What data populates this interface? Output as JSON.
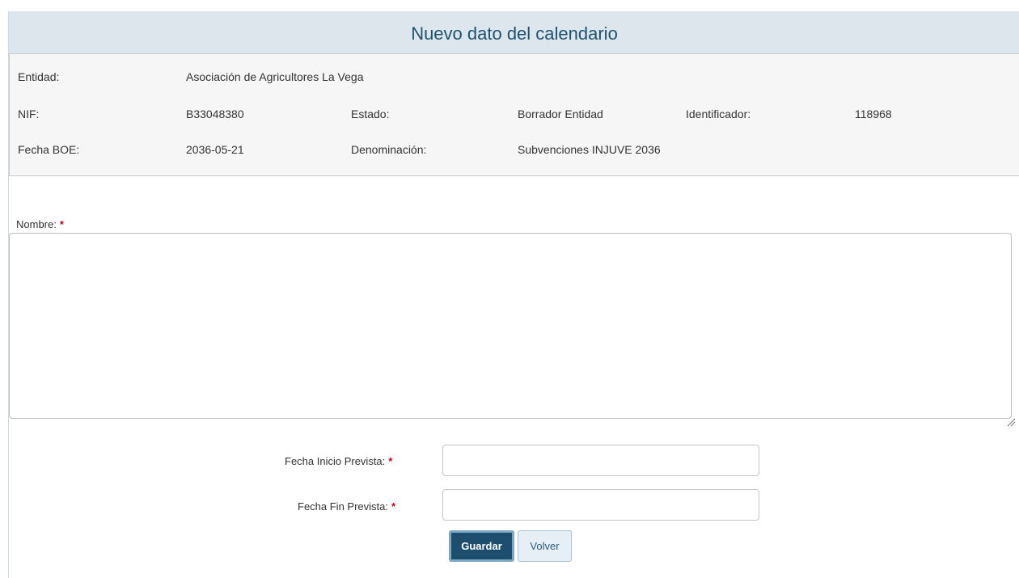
{
  "header": {
    "title": "Nuevo dato del calendario"
  },
  "info": {
    "entidad_label": "Entidad:",
    "entidad_value": "Asociación de Agricultores La Vega",
    "nif_label": "NIF:",
    "nif_value": "B33048380",
    "estado_label": "Estado:",
    "estado_value": "Borrador Entidad",
    "identificador_label": "Identificador:",
    "identificador_value": "118968",
    "fecha_boe_label": "Fecha BOE:",
    "fecha_boe_value": "2036-05-21",
    "denominacion_label": "Denominación:",
    "denominacion_value": "Subvenciones INJUVE 2036"
  },
  "form": {
    "nombre_label": "Nombre:",
    "nombre_value": "",
    "fecha_inicio_label": "Fecha Inicio Prevista:",
    "fecha_inicio_value": "",
    "fecha_fin_label": "Fecha Fin Prevista:",
    "fecha_fin_value": "",
    "required_mark": "*"
  },
  "buttons": {
    "save_label": "Guardar",
    "back_label": "Volver"
  },
  "colors": {
    "header_bg": "#dde6ec",
    "title": "#1f5270",
    "primary": "#1d4e6e",
    "required": "#d0021b"
  },
  "icons": {
    "resize": "resize-grip-icon"
  }
}
